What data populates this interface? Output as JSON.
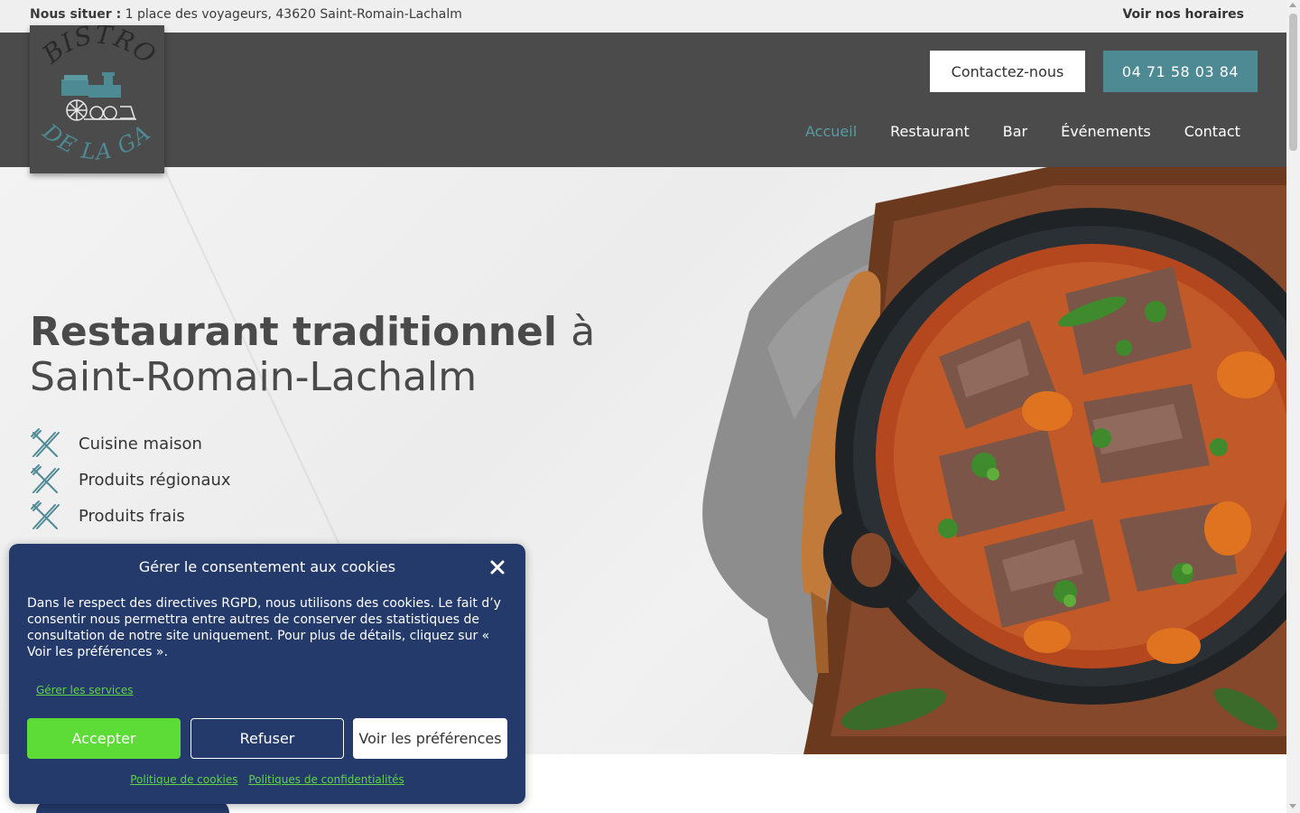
{
  "topbar": {
    "address_label": "Nous situer :",
    "address": "1 place des voyageurs, 43620 Saint-Romain-Lachalm",
    "hours_link": "Voir nos horaires"
  },
  "logo": {
    "alt_text": "Bistrot de la Gare"
  },
  "header": {
    "contact_button": "Contactez-nous",
    "phone_button": "04 71 58 03 84",
    "nav": [
      {
        "label": "Accueil",
        "active": true
      },
      {
        "label": "Restaurant",
        "active": false
      },
      {
        "label": "Bar",
        "active": false
      },
      {
        "label": "Événements",
        "active": false
      },
      {
        "label": "Contact",
        "active": false
      }
    ]
  },
  "hero": {
    "title_strong": "Restaurant traditionnel",
    "title_light_1": "à",
    "title_light_2": "Saint-Romain-Lachalm",
    "features": [
      {
        "icon": "cutlery-icon",
        "label": "Cuisine maison"
      },
      {
        "icon": "cutlery-icon",
        "label": "Produits régionaux"
      },
      {
        "icon": "cutlery-icon",
        "label": "Produits frais"
      }
    ]
  },
  "cookie": {
    "title": "Gérer le consentement aux cookies",
    "text": "Dans le respect des directives RGPD, nous utilisons des cookies. Le fait d’y consentir nous permettra entre autres de conserver des statistiques de consultation de notre site uniquement. Pour plus de détails, cliquez sur « Voir les préférences ».",
    "manage_services": "Gérer les services",
    "accept": "Accepter",
    "refuse": "Refuser",
    "preferences": "Voir les préférences",
    "cookie_policy": "Politique de cookies",
    "privacy_policy": "Politiques de confidentialités"
  },
  "colors": {
    "header_bg": "#4b4b4b",
    "accent_teal": "#4e8a94",
    "cookie_bg": "#243a6b",
    "cookie_accept": "#5ddb37"
  }
}
